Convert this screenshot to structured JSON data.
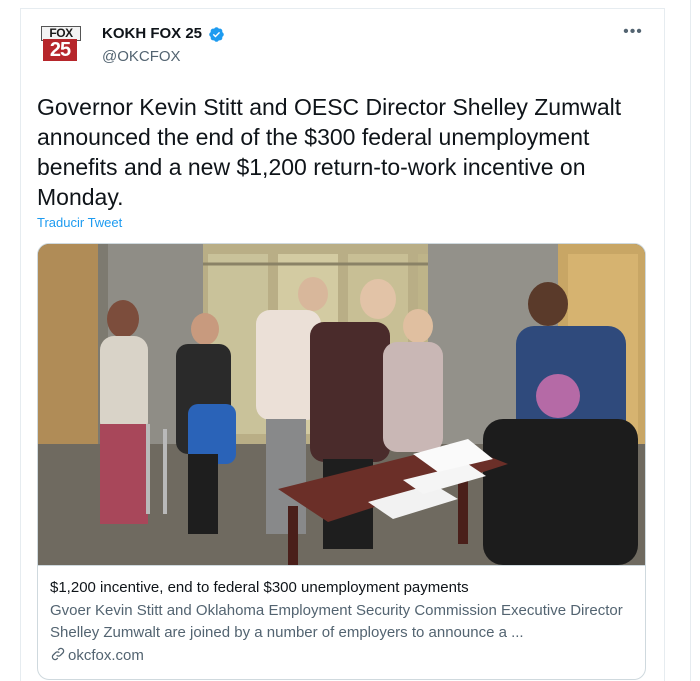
{
  "account": {
    "logo_top": "FOX",
    "logo_number": "25",
    "display_name": "KOKH FOX 25",
    "handle": "@OKCFOX",
    "verified": true
  },
  "menu": {
    "more_label": "•••"
  },
  "tweet": {
    "text": "Governor Kevin Stitt and OESC Director Shelley Zumwalt announced the end of the $300 federal unemployment benefits and a new $1,200 return-to-work incentive on Monday.",
    "translate_label": "Traducir Tweet"
  },
  "card": {
    "title": "$1,200 incentive, end to federal $300 unemployment payments",
    "description": "Gvoer Kevin Stitt and Oklahoma Employment Security Commission Executive Director Shelley Zumwalt are joined by a number of employers to announce a ...",
    "domain": "okcfox.com"
  },
  "colors": {
    "accent": "#1d9bf0",
    "secondary_text": "#536471",
    "border": "#cfd9de",
    "logo_red": "#b6262b"
  },
  "icons": {
    "verified": "verified-badge-icon",
    "more": "more-horizontal-icon",
    "link": "link-icon"
  }
}
